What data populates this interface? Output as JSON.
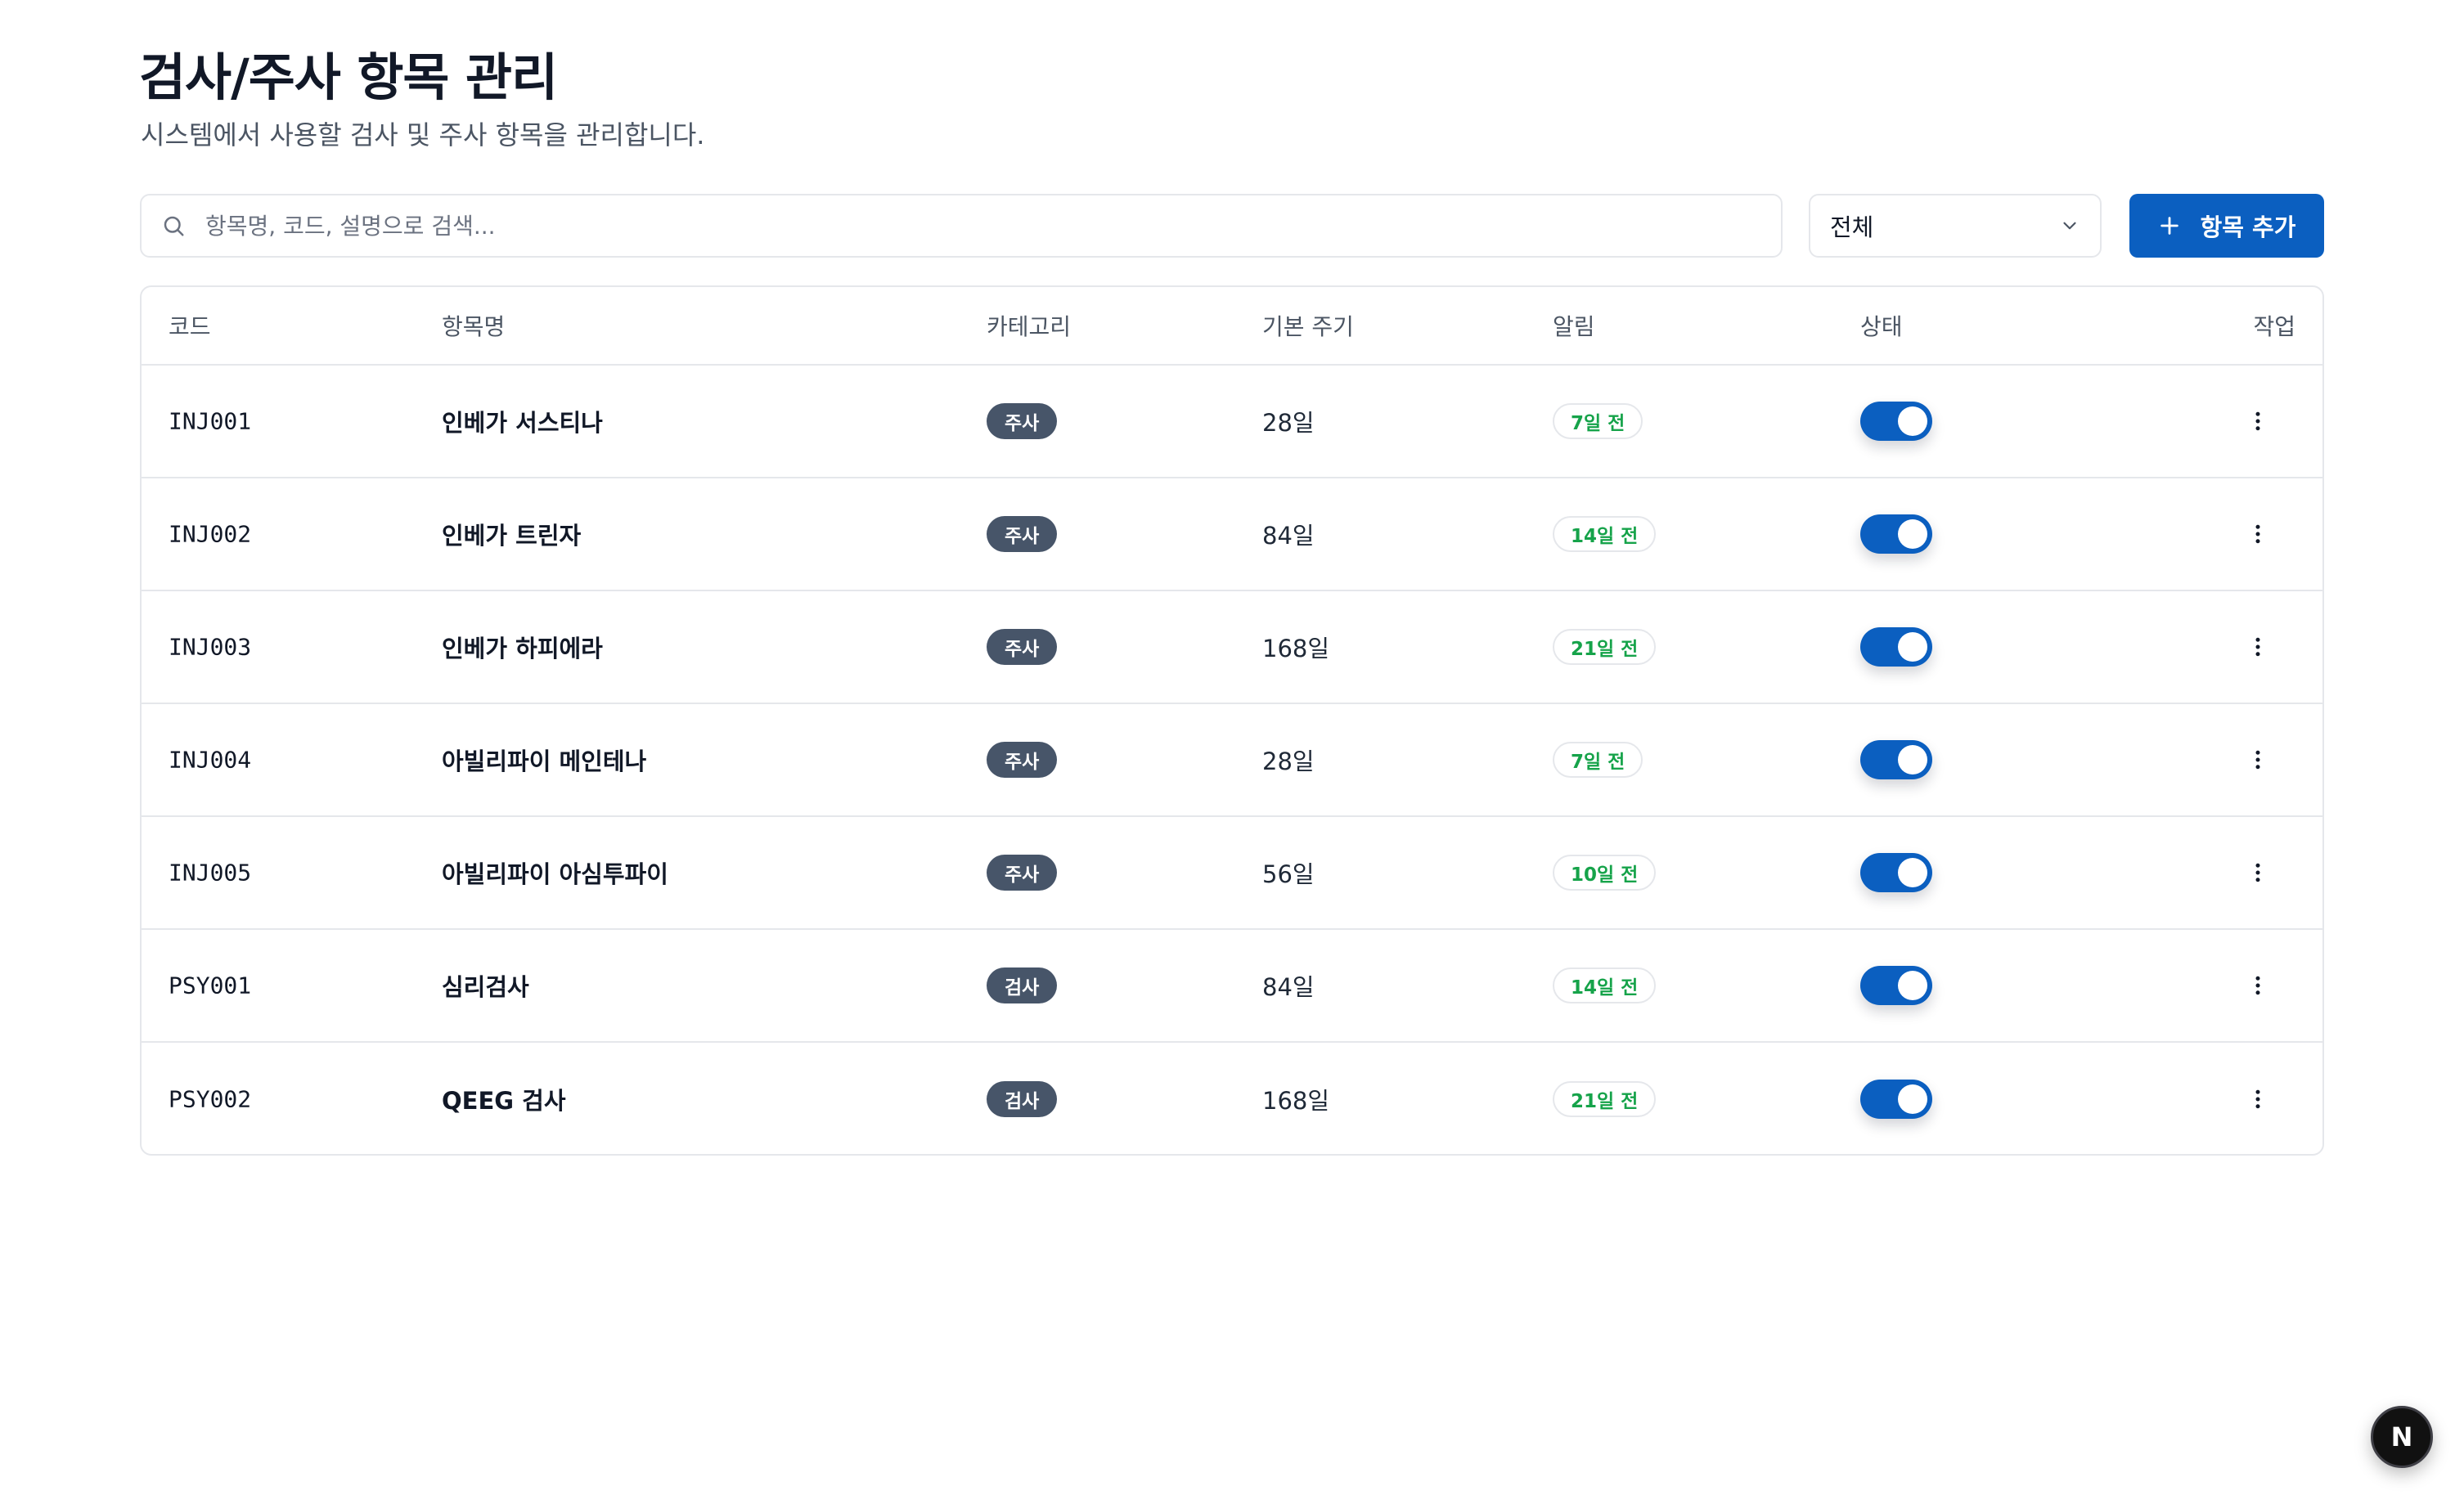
{
  "header": {
    "title": "검사/주사 항목 관리",
    "subtitle": "시스템에서 사용할 검사 및 주사 항목을 관리합니다."
  },
  "search": {
    "placeholder": "항목명, 코드, 설명으로 검색...",
    "value": ""
  },
  "filter": {
    "selected": "전체"
  },
  "add_button": {
    "label": "항목 추가"
  },
  "table": {
    "columns": [
      "코드",
      "항목명",
      "카테고리",
      "기본 주기",
      "알림",
      "상태",
      "작업"
    ],
    "rows": [
      {
        "code": "INJ001",
        "name": "인베가 서스티나",
        "category": "주사",
        "cycle": "28일",
        "alert": "7일 전",
        "enabled": true
      },
      {
        "code": "INJ002",
        "name": "인베가 트린자",
        "category": "주사",
        "cycle": "84일",
        "alert": "14일 전",
        "enabled": true
      },
      {
        "code": "INJ003",
        "name": "인베가 하피에라",
        "category": "주사",
        "cycle": "168일",
        "alert": "21일 전",
        "enabled": true
      },
      {
        "code": "INJ004",
        "name": "아빌리파이 메인테나",
        "category": "주사",
        "cycle": "28일",
        "alert": "7일 전",
        "enabled": true
      },
      {
        "code": "INJ005",
        "name": "아빌리파이 아심투파이",
        "category": "주사",
        "cycle": "56일",
        "alert": "10일 전",
        "enabled": true
      },
      {
        "code": "PSY001",
        "name": "심리검사",
        "category": "검사",
        "cycle": "84일",
        "alert": "14일 전",
        "enabled": true
      },
      {
        "code": "PSY002",
        "name": "QEEG 검사",
        "category": "검사",
        "cycle": "168일",
        "alert": "21일 전",
        "enabled": true
      }
    ]
  },
  "fab": {
    "label": "N"
  },
  "colors": {
    "primary": "#0b5fc0",
    "category_badge": "#475569",
    "alert_text": "#16a34a"
  },
  "icons": {
    "search": "search-icon",
    "select": "chevron-down-icon",
    "add": "plus-icon",
    "row_action": "more-vertical-icon"
  }
}
